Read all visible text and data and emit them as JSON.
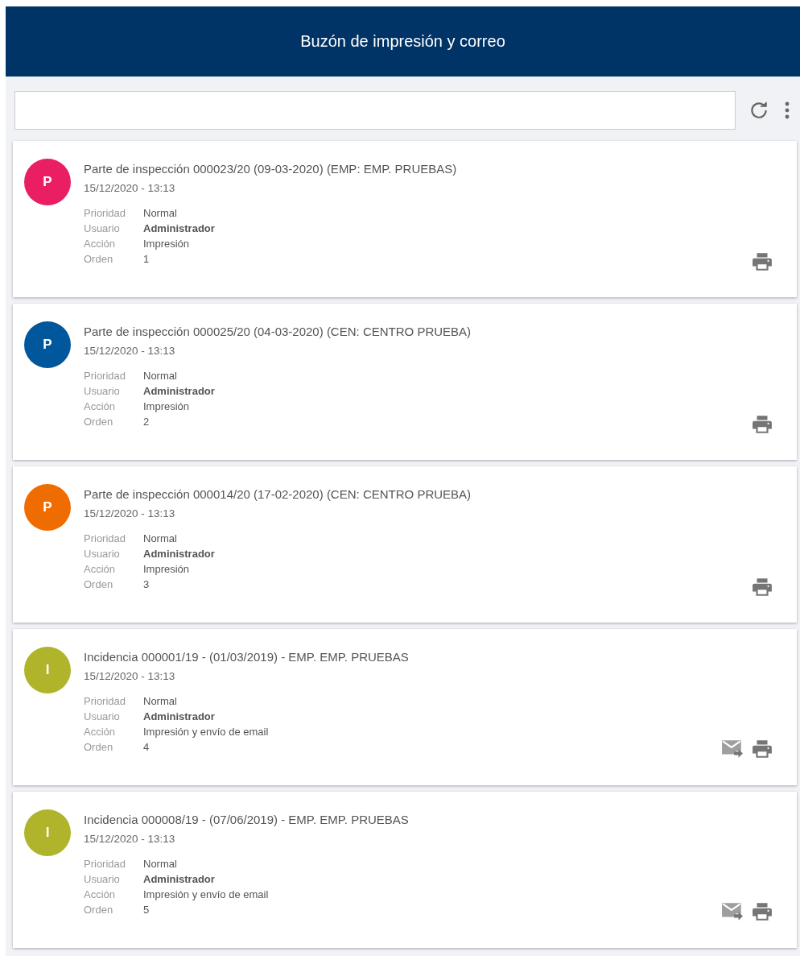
{
  "header": {
    "title": "Buzón de impresión y correo"
  },
  "items": [
    {
      "avatar": {
        "letter": "P",
        "color": "#e91e63"
      },
      "title": "Parte de inspección 000023/20 (09-03-2020) (EMP: EMP. PRUEBAS)",
      "date": "15/12/2020 - 13:13",
      "fields": [
        {
          "label": "Prioridad",
          "value": "Normal",
          "bold": false
        },
        {
          "label": "Usuario",
          "value": "Administrador",
          "bold": true
        },
        {
          "label": "Acción",
          "value": "Impresión",
          "bold": false
        },
        {
          "label": "Orden",
          "value": "1",
          "bold": false
        }
      ],
      "actions": [
        {
          "kind": "print"
        }
      ]
    },
    {
      "avatar": {
        "letter": "P",
        "color": "#01579b"
      },
      "title": "Parte de inspección 000025/20 (04-03-2020) (CEN: CENTRO PRUEBA)",
      "date": "15/12/2020 - 13:13",
      "fields": [
        {
          "label": "Prioridad",
          "value": "Normal",
          "bold": false
        },
        {
          "label": "Usuario",
          "value": "Administrador",
          "bold": true
        },
        {
          "label": "Acción",
          "value": "Impresión",
          "bold": false
        },
        {
          "label": "Orden",
          "value": "2",
          "bold": false
        }
      ],
      "actions": [
        {
          "kind": "print"
        }
      ]
    },
    {
      "avatar": {
        "letter": "P",
        "color": "#ef6c00"
      },
      "title": "Parte de inspección 000014/20 (17-02-2020) (CEN: CENTRO PRUEBA)",
      "date": "15/12/2020 - 13:13",
      "fields": [
        {
          "label": "Prioridad",
          "value": "Normal",
          "bold": false
        },
        {
          "label": "Usuario",
          "value": "Administrador",
          "bold": true
        },
        {
          "label": "Acción",
          "value": "Impresión",
          "bold": false
        },
        {
          "label": "Orden",
          "value": "3",
          "bold": false
        }
      ],
      "actions": [
        {
          "kind": "print"
        }
      ]
    },
    {
      "avatar": {
        "letter": "I",
        "color": "#afb42b"
      },
      "title": "Incidencia 000001/19 - (01/03/2019) - EMP. EMP. PRUEBAS",
      "date": "15/12/2020 - 13:13",
      "fields": [
        {
          "label": "Prioridad",
          "value": "Normal",
          "bold": false
        },
        {
          "label": "Usuario",
          "value": "Administrador",
          "bold": true
        },
        {
          "label": "Acción",
          "value": "Impresión y envío de email",
          "bold": false
        },
        {
          "label": "Orden",
          "value": "4",
          "bold": false
        }
      ],
      "actions": [
        {
          "kind": "email"
        },
        {
          "kind": "print"
        }
      ]
    },
    {
      "avatar": {
        "letter": "I",
        "color": "#afb42b"
      },
      "title": "Incidencia 000008/19 - (07/06/2019) - EMP. EMP. PRUEBAS",
      "date": "15/12/2020 - 13:13",
      "fields": [
        {
          "label": "Prioridad",
          "value": "Normal",
          "bold": false
        },
        {
          "label": "Usuario",
          "value": "Administrador",
          "bold": true
        },
        {
          "label": "Acción",
          "value": "Impresión y envío de email",
          "bold": false
        },
        {
          "label": "Orden",
          "value": "5",
          "bold": false
        }
      ],
      "actions": [
        {
          "kind": "email"
        },
        {
          "kind": "print"
        }
      ]
    }
  ]
}
